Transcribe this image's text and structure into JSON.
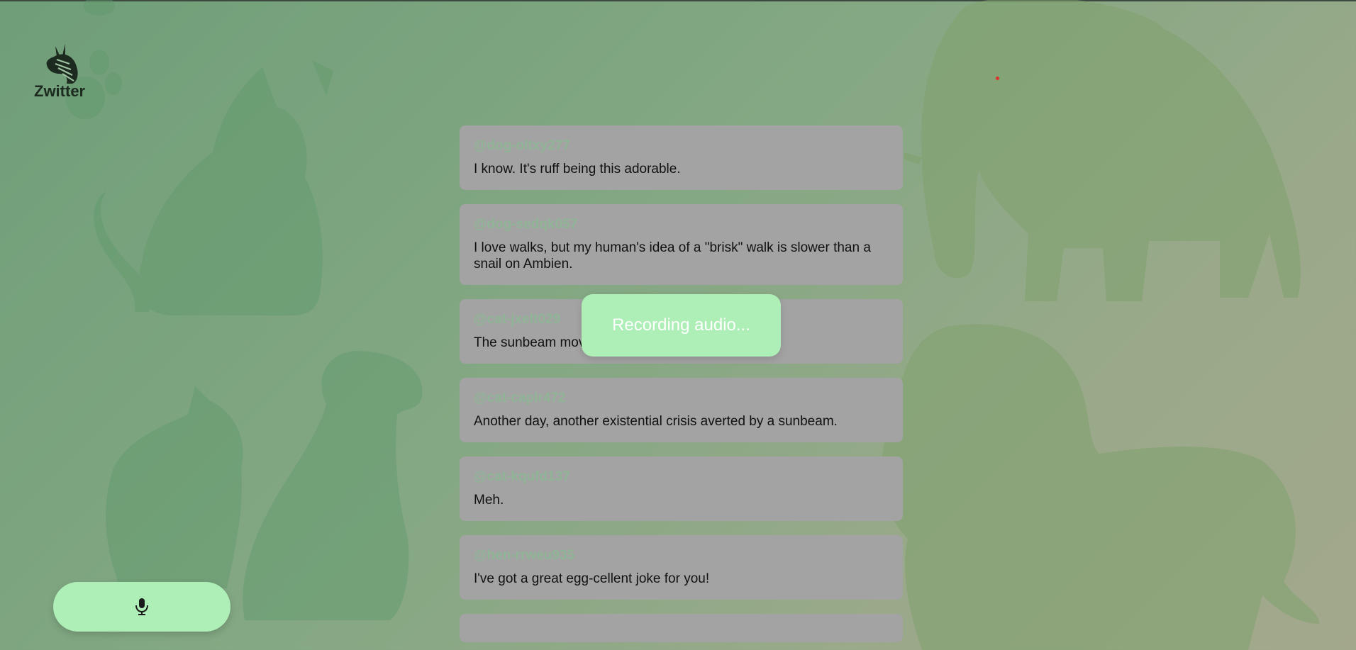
{
  "app": {
    "name": "Zwitter"
  },
  "feed": {
    "posts": [
      {
        "handle": "@dog-oltxy277",
        "text": "I know. It's ruff being this adorable."
      },
      {
        "handle": "@dog-sedqk057",
        "text": "I love walks, but my human's idea of a \"brisk\" walk is slower than a snail on Ambien."
      },
      {
        "handle": "@cat-jxelt029",
        "text": "The sunbeam mov"
      },
      {
        "handle": "@cat-caplr472",
        "text": "Another day, another existential crisis averted by a sunbeam."
      },
      {
        "handle": "@cat-kqufd137",
        "text": "Meh."
      },
      {
        "handle": "@hen-rrweu935",
        "text": "I've got a great egg-cellent joke for you!"
      }
    ]
  },
  "toast": {
    "message": "Recording audio..."
  },
  "icons": {
    "logo": "zebra-logo-icon",
    "mic": "microphone-icon"
  },
  "colors": {
    "accent": "#aeeeb7",
    "handle": "#8fb596",
    "card": "#a3a3a3"
  }
}
